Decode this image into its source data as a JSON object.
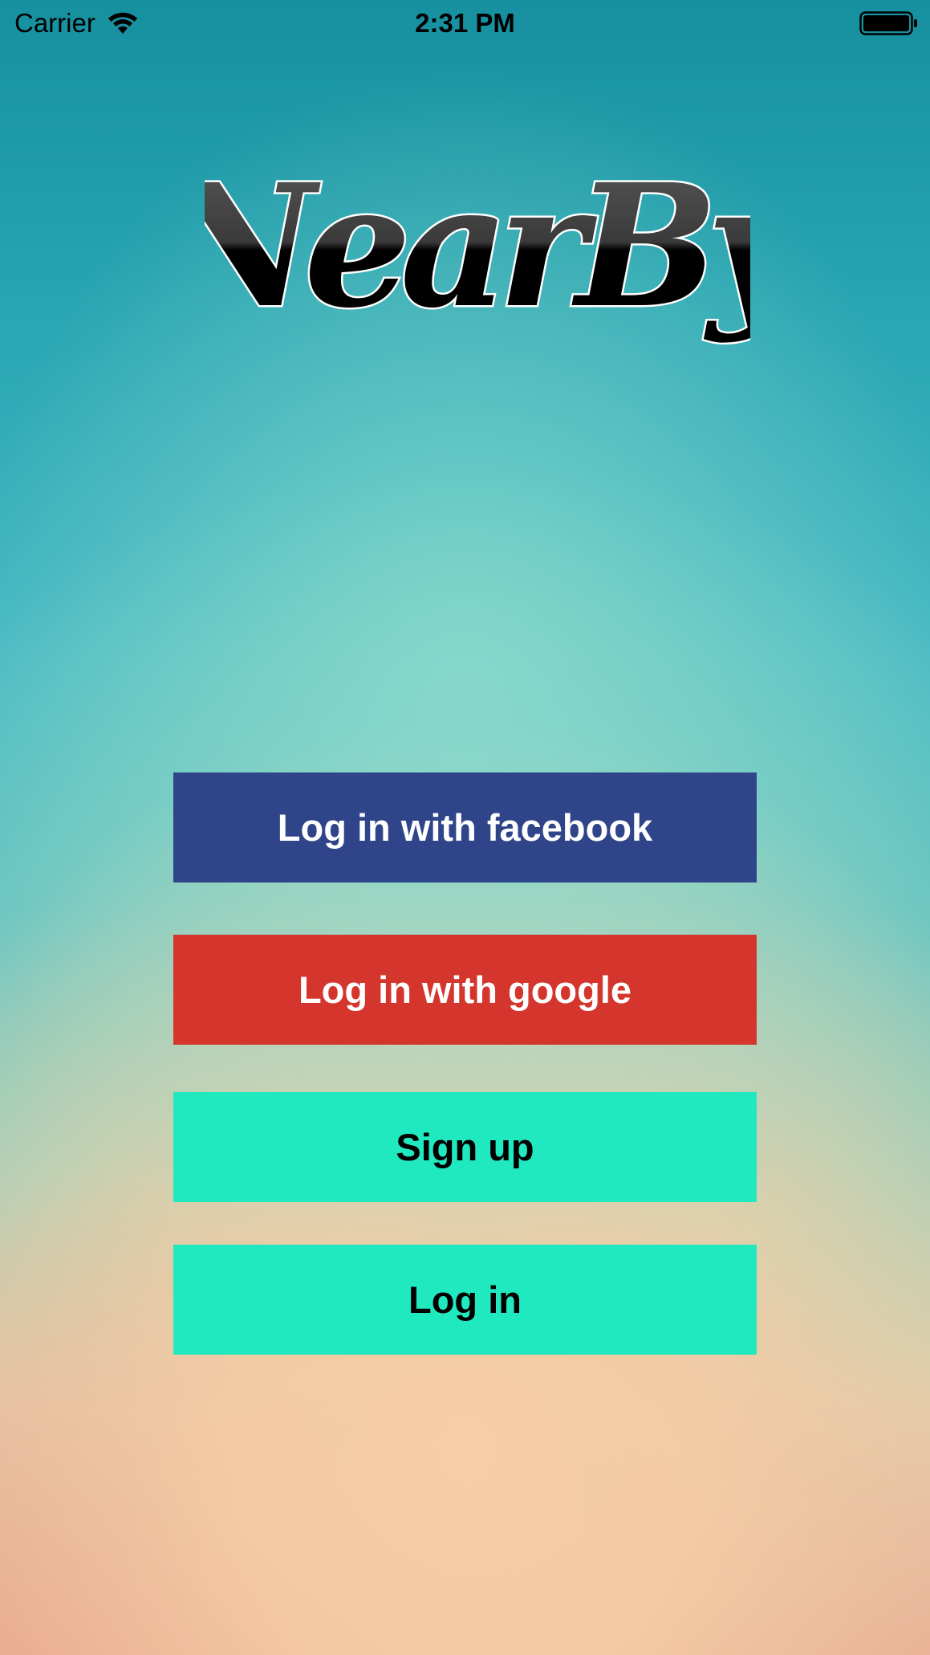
{
  "status_bar": {
    "carrier": "Carrier",
    "time": "2:31 PM",
    "wifi_icon": "wifi-icon",
    "battery_icon": "battery-full-icon"
  },
  "logo": {
    "text": "NearBy"
  },
  "buttons": {
    "facebook": {
      "label": "Log in with facebook",
      "color": "#2f4489"
    },
    "google": {
      "label": "Log in with google",
      "color": "#d4362d"
    },
    "signup": {
      "label": "Sign up",
      "color": "#20e8bf"
    },
    "login": {
      "label": "Log in",
      "color": "#20e8bf"
    }
  }
}
